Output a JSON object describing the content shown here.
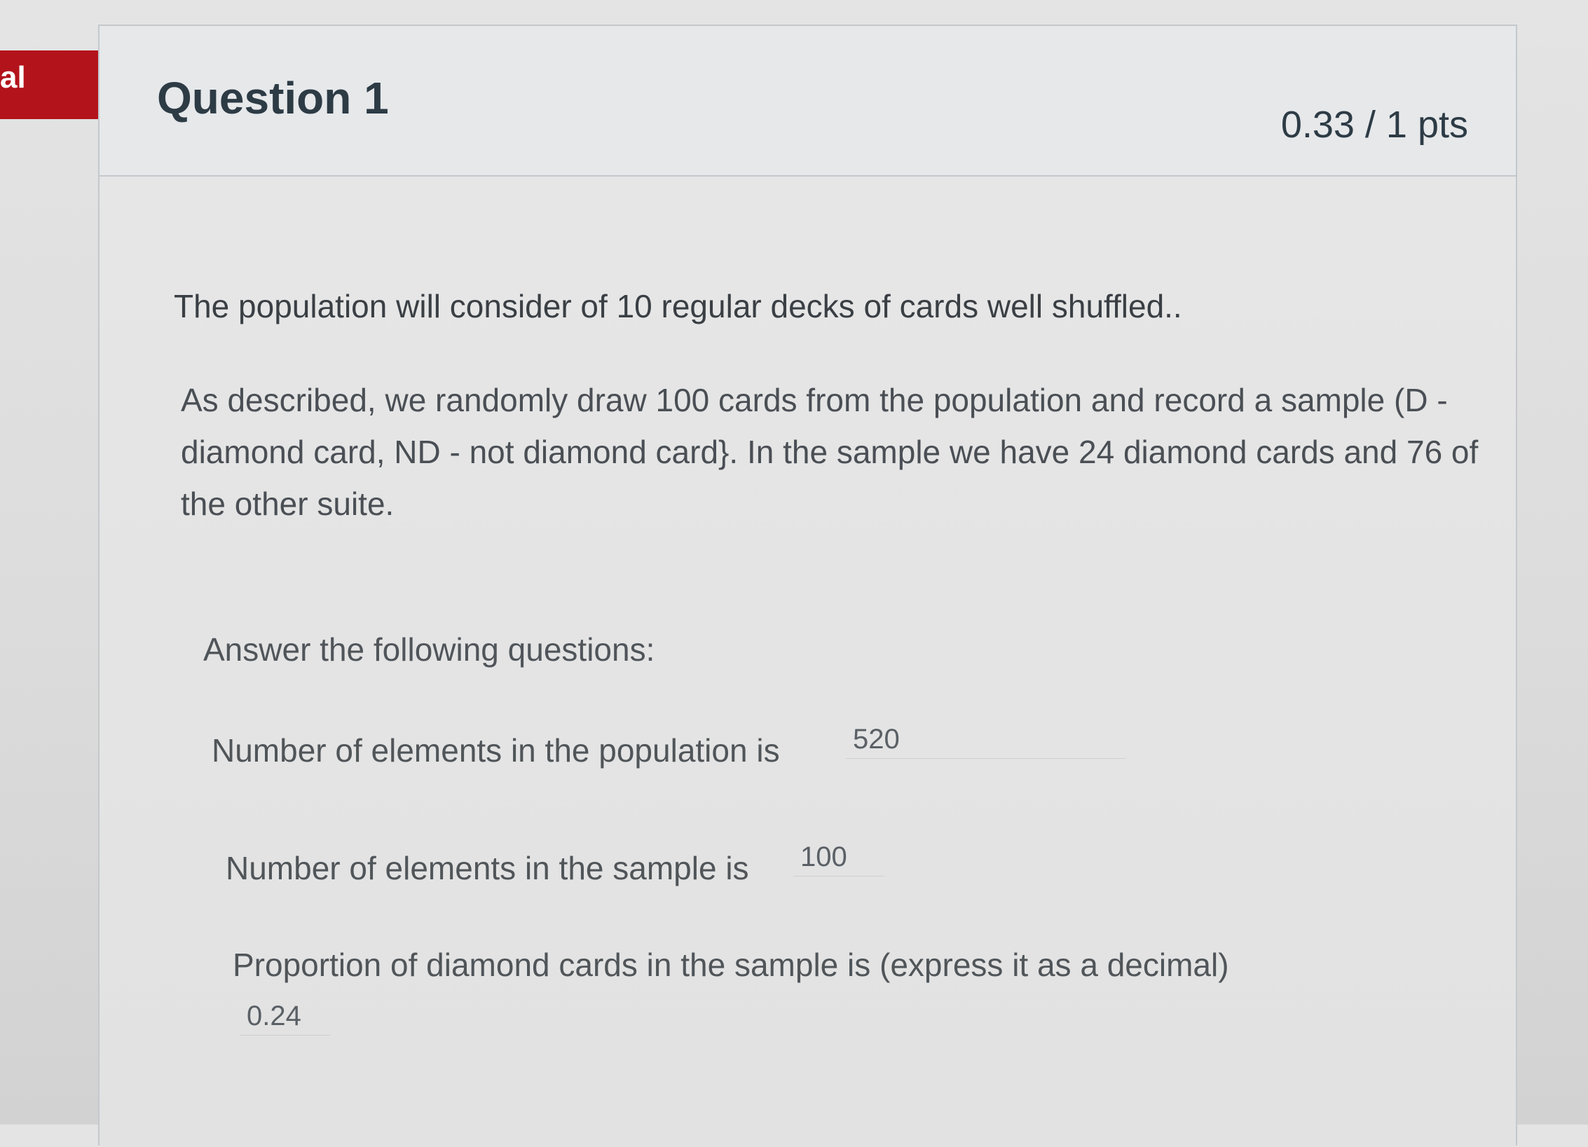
{
  "side_badge": {
    "text": "al",
    "color": "#b3131b"
  },
  "question": {
    "title": "Question 1",
    "points": "0.33 / 1 pts"
  },
  "body": {
    "paragraph1": "The population will consider of 10 regular decks of cards well shuffled..",
    "paragraph2": "As described, we randomly draw 100 cards from the population and record a sample (D - diamond card, ND - not diamond card}.   In the sample we have 24 diamond cards and 76 of the other suite.",
    "instructions": "Answer the following questions:",
    "q1_label": "Number of elements in the population is",
    "q1_answer": "520",
    "q2_label": "Number of elements in the sample is",
    "q2_answer": "100",
    "q3_label": "Proportion of diamond cards in the sample is (express it as a decimal)",
    "q3_answer": "0.24"
  }
}
